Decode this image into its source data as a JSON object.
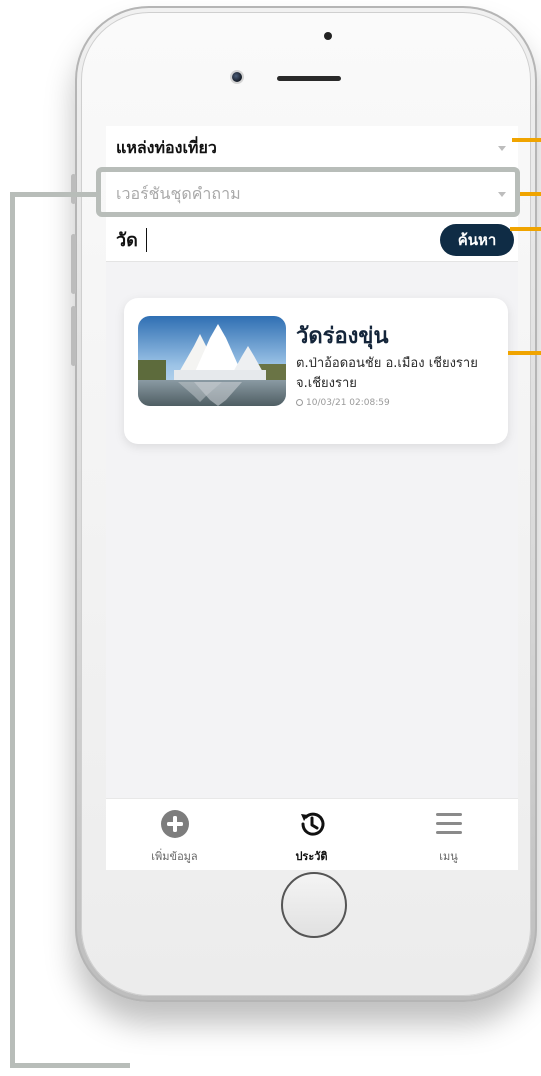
{
  "header": {
    "category_select": {
      "value": "แหล่งท่องเที่ยว"
    },
    "version_select": {
      "placeholder": "เวอร์ชันชุดคำถาม"
    }
  },
  "search": {
    "value": "วัด",
    "button_label": "ค้นหา"
  },
  "results": [
    {
      "title": "วัดร่องขุ่น",
      "address": "ต.ป่าอ้อดอนชัย อ.เมือง เชียงราย จ.เชียงราย",
      "timestamp": "10/03/21 02:08:59"
    }
  ],
  "tab_bar": {
    "items": [
      {
        "label": "เพิ่มข้อมูล",
        "icon": "add-circle-icon",
        "active": false
      },
      {
        "label": "ประวัติ",
        "icon": "history-icon",
        "active": true
      },
      {
        "label": "เมนู",
        "icon": "menu-icon",
        "active": false
      }
    ]
  },
  "colors": {
    "primary": "#0f2c45",
    "annotation": "#f0a400",
    "bracket": "#b8bdb9"
  }
}
